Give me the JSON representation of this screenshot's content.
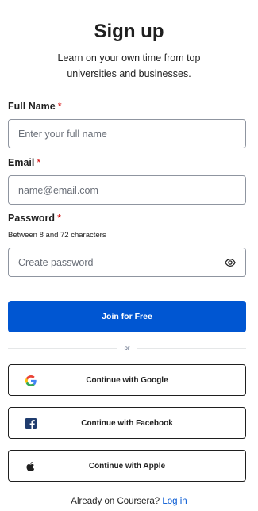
{
  "header": {
    "title": "Sign up",
    "subtitle": "Learn on your own time from top universities and businesses."
  },
  "form": {
    "full_name": {
      "label": "Full Name",
      "required_mark": "*",
      "placeholder": "Enter your full name"
    },
    "email": {
      "label": "Email",
      "required_mark": "*",
      "placeholder": "name@email.com"
    },
    "password": {
      "label": "Password",
      "required_mark": "*",
      "hint": "Between 8 and 72 characters",
      "placeholder": "Create password",
      "toggle_icon": "eye-icon"
    },
    "submit_label": "Join for Free"
  },
  "divider": {
    "label": "or"
  },
  "social": {
    "google": {
      "label": "Continue with Google",
      "icon": "google-icon"
    },
    "facebook": {
      "label": "Continue with Facebook",
      "icon": "facebook-icon"
    },
    "apple": {
      "label": "Continue with Apple",
      "icon": "apple-icon"
    }
  },
  "footer": {
    "prompt": "Already on Coursera?",
    "link_label": "Log in"
  },
  "colors": {
    "primary": "#0056d2",
    "required": "#d30001",
    "text": "#1f1f1f",
    "field_border": "#8f95a0"
  }
}
